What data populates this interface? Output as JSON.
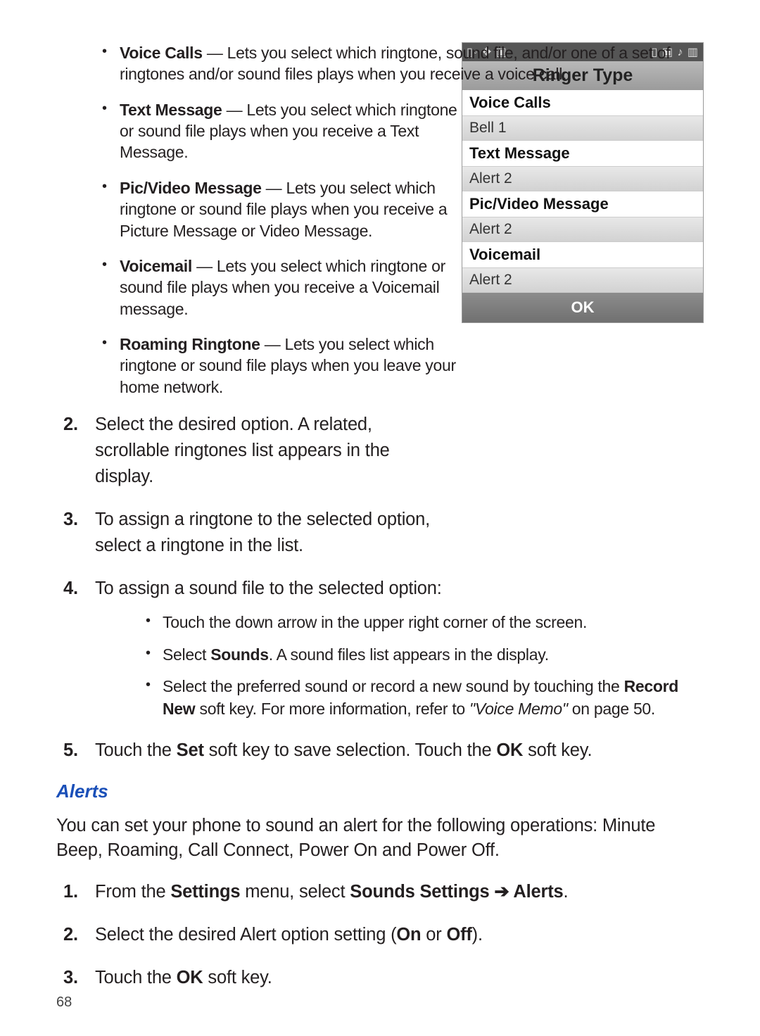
{
  "bullets_top": [
    {
      "term": "Voice Calls",
      "desc": " — Lets you select which ringtone, sound file, and/or one of a set of ringtones and/or sound files plays when you receive a voice call."
    },
    {
      "term": "Text Message",
      "desc": " — Lets you select which ringtone or sound file plays when you receive a Text Message."
    },
    {
      "term": "Pic/Video Message",
      "desc": " — Lets you select which ringtone or sound file plays when you receive a Picture Message or Video Message."
    },
    {
      "term": "Voicemail",
      "desc": " — Lets you select which ringtone or sound file plays when you receive a Voicemail message."
    },
    {
      "term": "Roaming Ringtone",
      "desc": " — Lets you select which ringtone or sound file plays when you leave your home network."
    }
  ],
  "steps_a": {
    "s2_num": "2.",
    "s2": "Select the desired option. A related, scrollable ringtones list appears in the display.",
    "s3_num": "3.",
    "s3": "To assign a ringtone to the selected option, select a ringtone in the list.",
    "s4_num": "4.",
    "s4": "To assign a sound file to the selected option:",
    "s4_subs": [
      "Touch the down arrow in the upper right corner of the screen.",
      "Select <b>Sounds</b>. A sound files list appears in the display.",
      "Select the preferred sound or record a new sound by touching the <b>Record New</b> soft key. For more information, refer to <span class=\"em\">\"Voice Memo\"</span>  on page 50."
    ],
    "s5_num": "5.",
    "s5": "Touch the <b>Set</b> soft key to save selection. Touch the <b>OK</b> soft key."
  },
  "section_title": "Alerts",
  "alerts_intro": "You can set your phone to sound an alert for the following operations: Minute Beep, Roaming, Call Connect, Power On and Power Off.",
  "steps_b": {
    "s1_num": "1.",
    "s1": "From the <b>Settings</b> menu, select <b>Sounds Settings ➔ Alerts</b>.",
    "s2_num": "2.",
    "s2": "Select the desired Alert option setting (<b>On</b> or <b>Off</b>).",
    "s3_num": "3.",
    "s3": "Touch the <b>OK</b> soft key."
  },
  "page_number": "68",
  "phone": {
    "status_left": "▯◦ ✥ ▣",
    "status_right": "▯ ▣ ♪ ▥",
    "title": "Ringer Type",
    "rows": [
      {
        "label": "Voice Calls",
        "value": "Bell 1"
      },
      {
        "label": "Text Message",
        "value": "Alert 2"
      },
      {
        "label": "Pic/Video Message",
        "value": "Alert 2"
      },
      {
        "label": "Voicemail",
        "value": "Alert 2"
      }
    ],
    "ok": "OK"
  }
}
